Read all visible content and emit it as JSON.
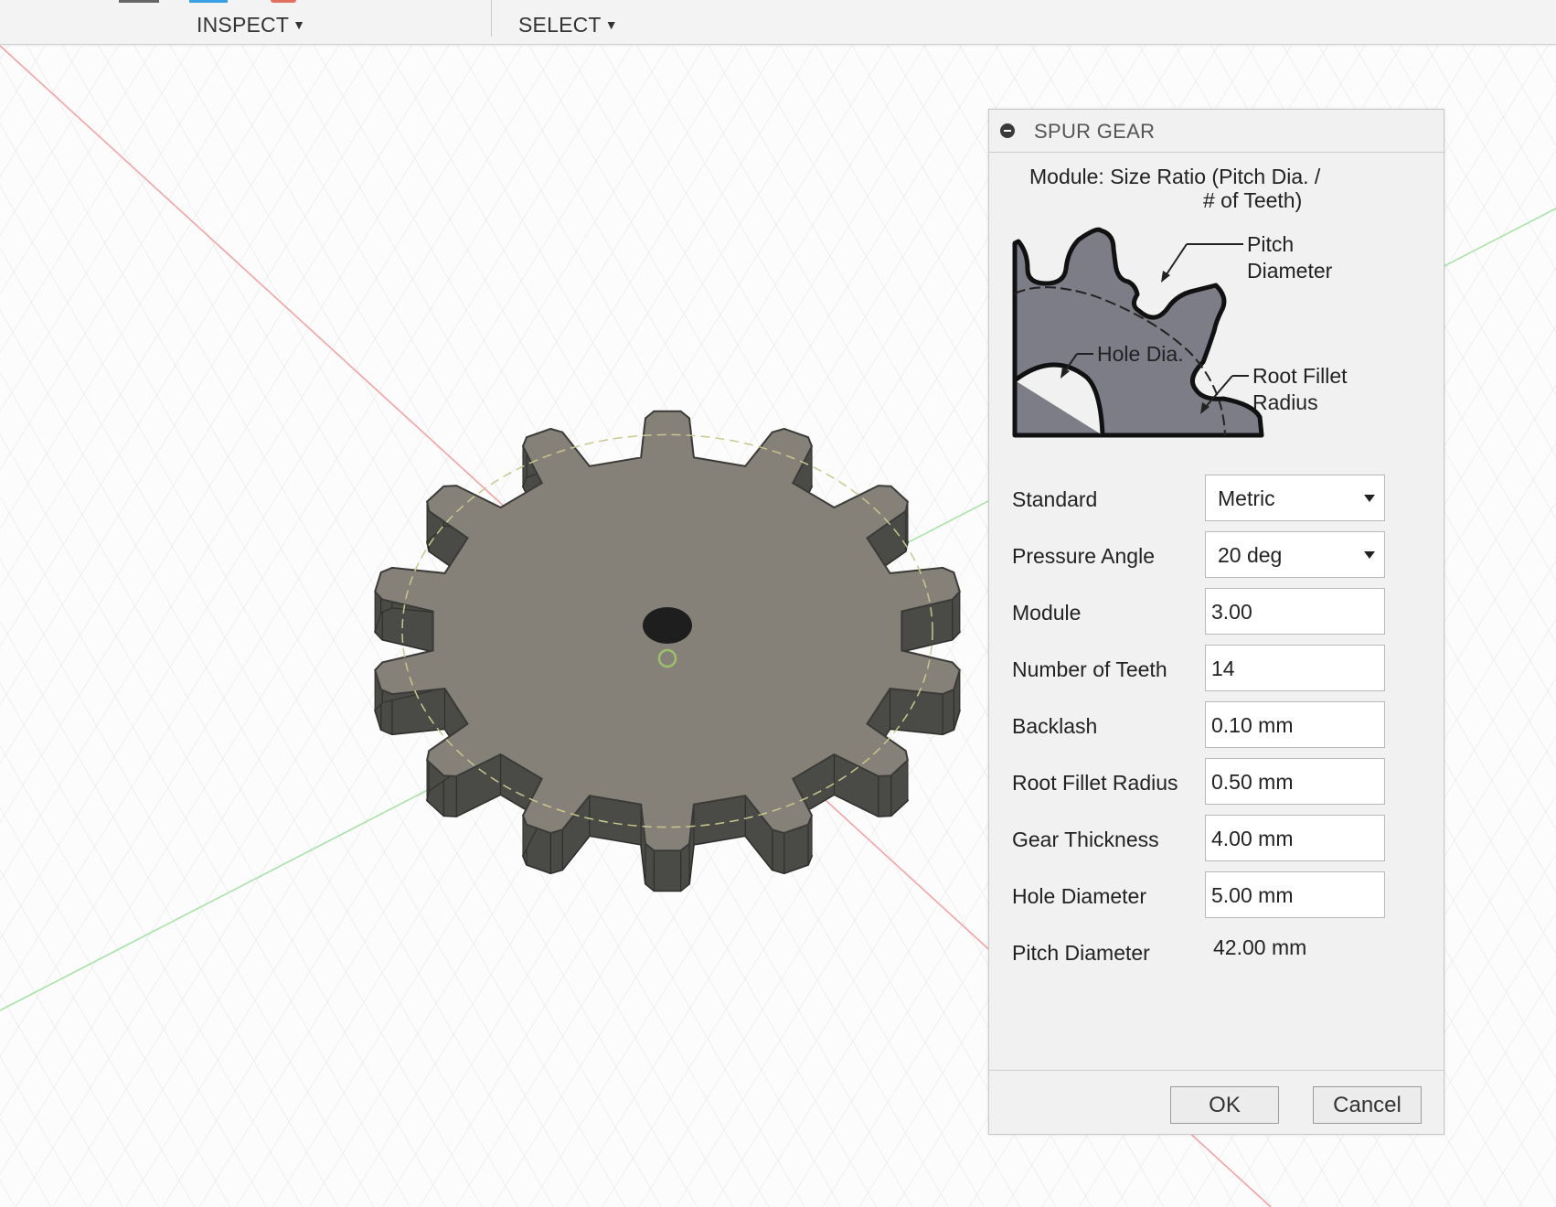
{
  "toolbar": {
    "menus": [
      {
        "label": "INSPECT"
      },
      {
        "label": "SELECT"
      }
    ]
  },
  "dialog": {
    "title": "SPUR GEAR",
    "diagram": {
      "module_caption_line1": "Module: Size Ratio (Pitch Dia. /",
      "module_caption_line2": "# of Teeth)",
      "pitch_diameter_line1": "Pitch",
      "pitch_diameter_line2": "Diameter",
      "hole_dia": "Hole Dia.",
      "root_fillet_line1": "Root Fillet",
      "root_fillet_line2": "Radius"
    },
    "fields": {
      "standard": {
        "label": "Standard",
        "value": "Metric"
      },
      "pressure_angle": {
        "label": "Pressure Angle",
        "value": "20 deg"
      },
      "module": {
        "label": "Module",
        "value": "3.00"
      },
      "number_of_teeth": {
        "label": "Number of Teeth",
        "value": "14"
      },
      "backlash": {
        "label": "Backlash",
        "value": "0.10 mm"
      },
      "root_fillet_radius": {
        "label": "Root Fillet Radius",
        "value": "0.50 mm"
      },
      "gear_thickness": {
        "label": "Gear Thickness",
        "value": "4.00 mm"
      },
      "hole_diameter": {
        "label": "Hole Diameter",
        "value": "5.00 mm"
      },
      "pitch_diameter": {
        "label": "Pitch Diameter",
        "value": "42.00 mm"
      }
    },
    "buttons": {
      "ok": "OK",
      "cancel": "Cancel"
    }
  },
  "colors": {
    "gear_top": "#858178",
    "gear_side": "#4a4a46",
    "grid_line": "#e3e3e3",
    "axis_red": "#f08080",
    "axis_green": "#8fd88f"
  }
}
